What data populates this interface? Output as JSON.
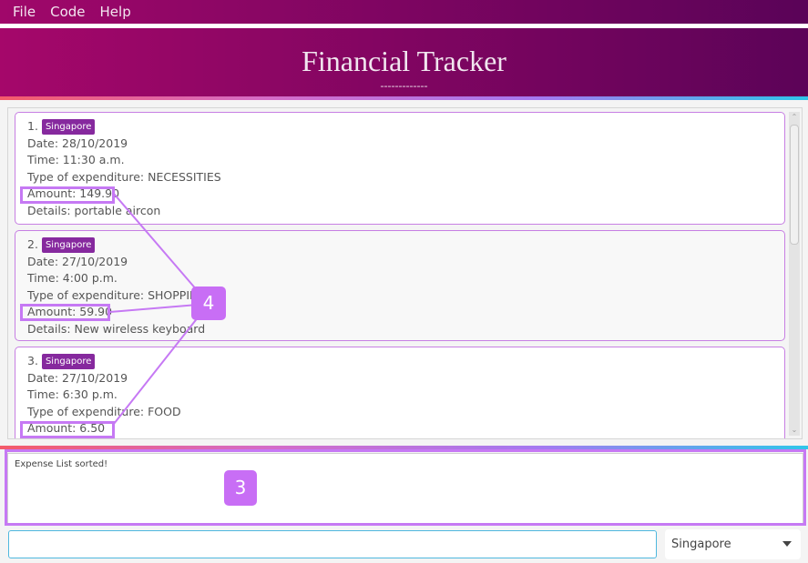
{
  "menu": [
    "File",
    "Code",
    "Help"
  ],
  "header": {
    "title": "Financial Tracker",
    "underline": "-------------"
  },
  "expenses": [
    {
      "index": "1.",
      "country": "Singapore",
      "date": "Date: 28/10/2019",
      "time": "Time: 11:30 a.m.",
      "type": "Type of expenditure: NECESSITIES",
      "amount": "Amount: 149.90",
      "details": "Details: portable aircon"
    },
    {
      "index": "2.",
      "country": "Singapore",
      "date": "Date: 27/10/2019",
      "time": "Time: 4:00 p.m.",
      "type": "Type of expenditure: SHOPPING",
      "amount": "Amount: 59.90",
      "details": "Details: New wireless keyboard"
    },
    {
      "index": "3.",
      "country": "Singapore",
      "date": "Date: 27/10/2019",
      "time": "Time: 6:30 p.m.",
      "type": "Type of expenditure: FOOD",
      "amount": "Amount: 6.50",
      "details": ""
    }
  ],
  "result": {
    "message": "Expense List sorted!"
  },
  "command": {
    "value": "",
    "placeholder": ""
  },
  "country_select": {
    "selected": "Singapore"
  },
  "annotations": {
    "result_badge": "3",
    "amount_badge": "4"
  },
  "colors": {
    "accent": "#c679f4",
    "tag": "#86299e",
    "header_start": "#a5076a",
    "header_end": "#5c0358"
  }
}
